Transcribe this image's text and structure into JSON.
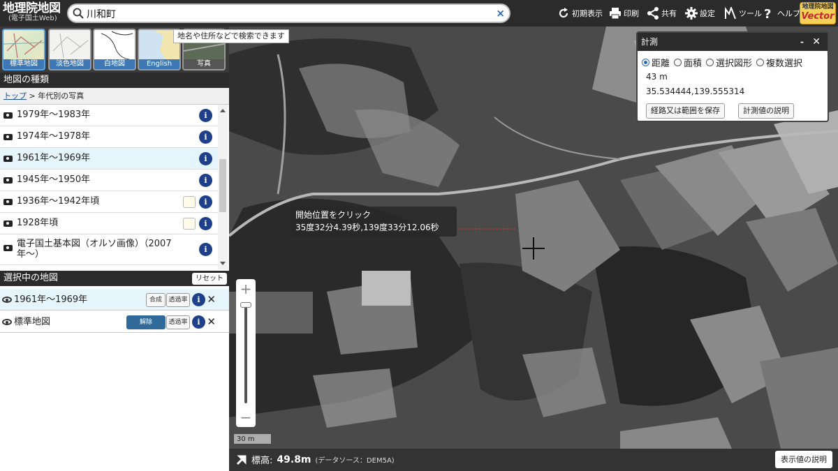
{
  "header": {
    "logo_title": "地理院地図",
    "logo_sub": "(電子国土Web)",
    "search_value": "川和町",
    "search_clear": "×",
    "buttons": {
      "home": "初期表示",
      "print": "印刷",
      "share": "共有",
      "settings": "設定",
      "tools": "ツール",
      "help": "ヘルプ"
    },
    "vector_badge": {
      "top": "地理院地図",
      "bottom": "Vector"
    }
  },
  "basemaps": {
    "items": [
      {
        "label": "標準地図",
        "icon": "standard-map-thumb"
      },
      {
        "label": "淡色地図",
        "icon": "pale-map-thumb"
      },
      {
        "label": "白地図",
        "icon": "blank-map-thumb"
      },
      {
        "label": "English",
        "icon": "english-map-thumb"
      },
      {
        "label": "写真",
        "icon": "photo-thumb"
      }
    ],
    "tooltip": "地名や住所などで検索できます"
  },
  "map_types": {
    "header": "地図の種類",
    "breadcrumb_top": "トップ",
    "breadcrumb_sep": ">",
    "breadcrumb_current": "年代別の写真",
    "items": [
      {
        "label": "1979年〜1983年"
      },
      {
        "label": "1974年〜1978年"
      },
      {
        "label": "1961年〜1969年"
      },
      {
        "label": "1945年〜1950年"
      },
      {
        "label": "1936年〜1942年頃"
      },
      {
        "label": "1928年頃"
      },
      {
        "label": "電子国土基本図（オルソ画像）（2007年〜）"
      }
    ],
    "info_glyph": "i"
  },
  "selected": {
    "header": "選択中の地図",
    "reset": "リセット",
    "rows": [
      {
        "label": "1961年〜1969年",
        "btn1": "合成",
        "btn2": "透過率"
      },
      {
        "label": "標準地図",
        "btn1": "解除",
        "btn2": "透過率"
      }
    ],
    "remove": "✕"
  },
  "measure": {
    "title": "計測",
    "minimize": "-",
    "close": "✕",
    "options": [
      "距離",
      "面積",
      "選択図形",
      "複数選択"
    ],
    "selected_option": "距離",
    "distance": "43 m",
    "coords": "35.534444,139.555314",
    "save_btn": "経路又は範囲を保存",
    "explain_btn": "計測値の説明"
  },
  "popup": {
    "line1": "開始位置をクリック",
    "line2": "35度32分4.39秒,139度33分12.06秒"
  },
  "zoom": {
    "plus": "+",
    "minus": "−"
  },
  "scale": "30 m",
  "footer": {
    "elev_label": "標高:",
    "elev_value": "49.8m",
    "elev_source": "(データソース：DEM5A)",
    "explain_btn": "表示値の説明"
  }
}
